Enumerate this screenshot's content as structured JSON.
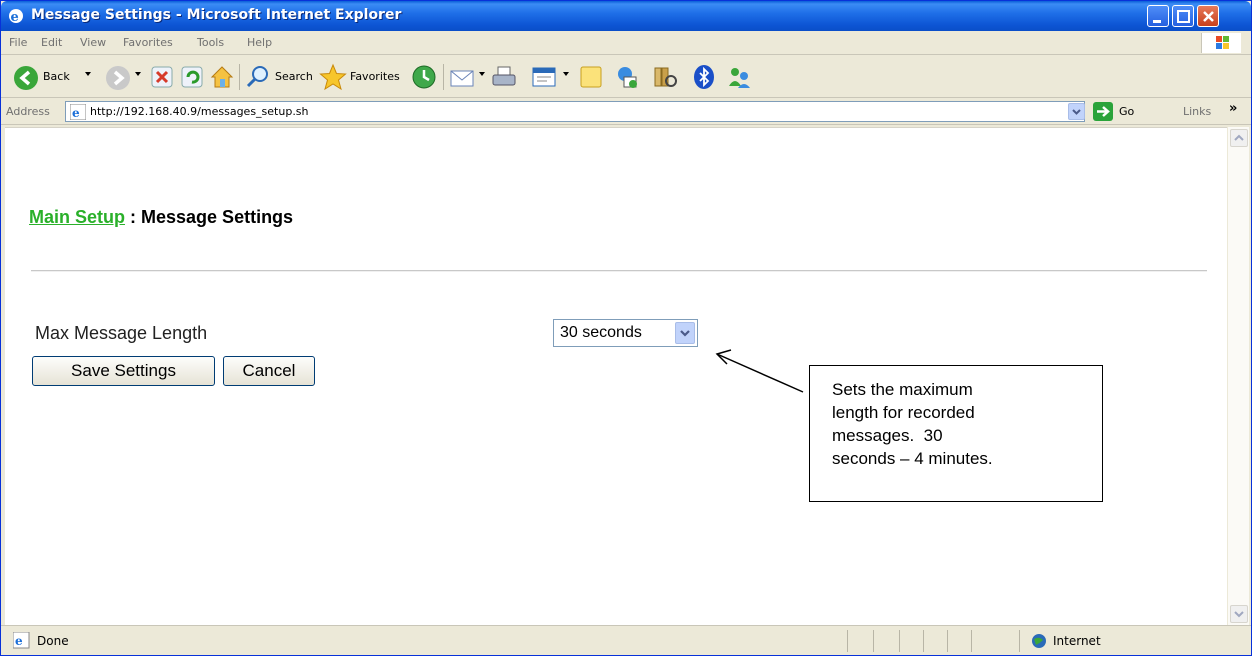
{
  "window": {
    "title": "Message Settings - Microsoft Internet Explorer"
  },
  "menu": {
    "items": [
      "File",
      "Edit",
      "View",
      "Favorites",
      "Tools",
      "Help"
    ]
  },
  "toolbar": {
    "back_label": "Back",
    "search_label": "Search",
    "favorites_label": "Favorites"
  },
  "address": {
    "label": "Address",
    "url": "http://192.168.40.9/messages_setup.sh",
    "go_label": "Go",
    "links_label": "Links",
    "links_chevron": "»"
  },
  "page": {
    "breadcrumb_link": "Main Setup",
    "breadcrumb_sep": " : ",
    "title": "Message Settings",
    "field_label": "Max Message Length",
    "select_value": "30 seconds",
    "save_label": "Save Settings",
    "cancel_label": "Cancel"
  },
  "callout": {
    "text": "Sets the maximum\nlength for recorded\nmessages.  30\nseconds – 4 minutes."
  },
  "status": {
    "text": "Done",
    "zone": "Internet"
  },
  "colors": {
    "titlebar": "#0d55d4",
    "link": "#2ab02a",
    "chrome": "#ece9d8"
  }
}
